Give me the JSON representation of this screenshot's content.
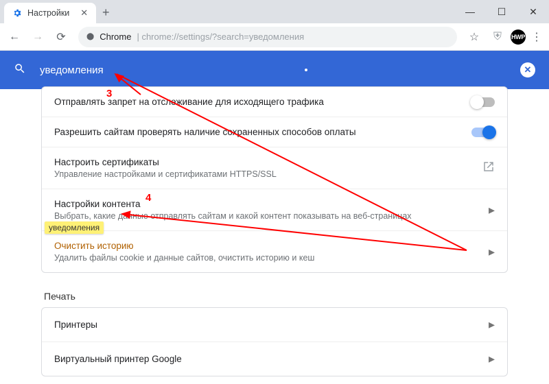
{
  "window": {
    "tab_title": "Настройки",
    "new_tab_glyph": "+",
    "controls": {
      "min": "—",
      "max": "☐",
      "close": "✕"
    }
  },
  "toolbar": {
    "back": "←",
    "forward": "→",
    "reload": "⟳",
    "secure_icon": "⬤",
    "url_host": "Chrome",
    "url_sep": " | ",
    "url_path": "chrome://settings/?search=уведомления",
    "star": "☆",
    "shield": "⛨",
    "avatar_text": "HWP",
    "menu": "⋮"
  },
  "search_header": {
    "icon": "search",
    "query": "уведомления",
    "clear": "✕"
  },
  "settings": {
    "rows": [
      {
        "title": "Отправлять запрет на отслеживание для исходящего трафика",
        "sub": "",
        "control": "toggle-off"
      },
      {
        "title": "Разрешить сайтам проверять наличие сохраненных способов оплаты",
        "sub": "",
        "control": "toggle-on"
      },
      {
        "title": "Настроить сертификаты",
        "sub": "Управление настройками и сертификатами HTTPS/SSL",
        "control": "external"
      },
      {
        "title": "Настройки контента",
        "sub": "Выбрать, какие данные отправлять сайтам и какой контент показывать на веб-страницах",
        "control": "chevron"
      },
      {
        "title": "Очистить историю",
        "sub": "Удалить файлы cookie и данные сайтов, очистить историю и кеш",
        "control": "chevron",
        "highlight": "уведомления"
      }
    ],
    "section_print": "Печать",
    "print_rows": [
      {
        "title": "Принтеры",
        "control": "chevron"
      },
      {
        "title": "Виртуальный принтер Google",
        "control": "chevron"
      }
    ]
  },
  "annotations": {
    "label3": "3",
    "label4": "4"
  },
  "colors": {
    "accent": "#3367d6",
    "toggle_on": "#1a73e8",
    "highlight": "#fff176",
    "arrow": "#ff0000"
  }
}
